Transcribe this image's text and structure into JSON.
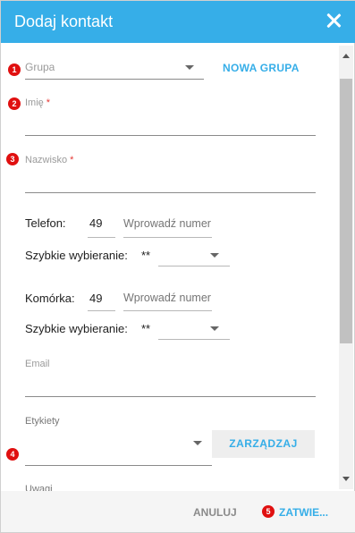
{
  "dialog": {
    "title": "Dodaj kontakt"
  },
  "group": {
    "placeholder": "Grupa",
    "new_group_label": "NOWA GRUPA"
  },
  "first_name": {
    "label": "Imię",
    "required_mark": "*"
  },
  "last_name": {
    "label": "Nazwisko",
    "required_mark": "*"
  },
  "phone": {
    "label": "Telefon:",
    "prefix": "49",
    "number_placeholder": "Wprowadź numer",
    "speed_dial_label": "Szybkie wybieranie:",
    "speed_dial_value": "**"
  },
  "mobile": {
    "label": "Komórka:",
    "prefix": "49",
    "number_placeholder": "Wprowadź numer",
    "speed_dial_label": "Szybkie wybieranie:",
    "speed_dial_value": "**"
  },
  "email": {
    "label": "Email"
  },
  "tags": {
    "label": "Etykiety",
    "manage_label": "ZARZĄDZAJ"
  },
  "notes": {
    "label": "Uwagi"
  },
  "footer": {
    "cancel_label": "ANULUJ",
    "confirm_label": "ZATWIE..."
  },
  "markers": [
    "1",
    "2",
    "3",
    "4",
    "5"
  ],
  "colors": {
    "header": "#36aee8",
    "accent": "#36aee8",
    "marker": "#e01010",
    "required": "#e53935"
  }
}
